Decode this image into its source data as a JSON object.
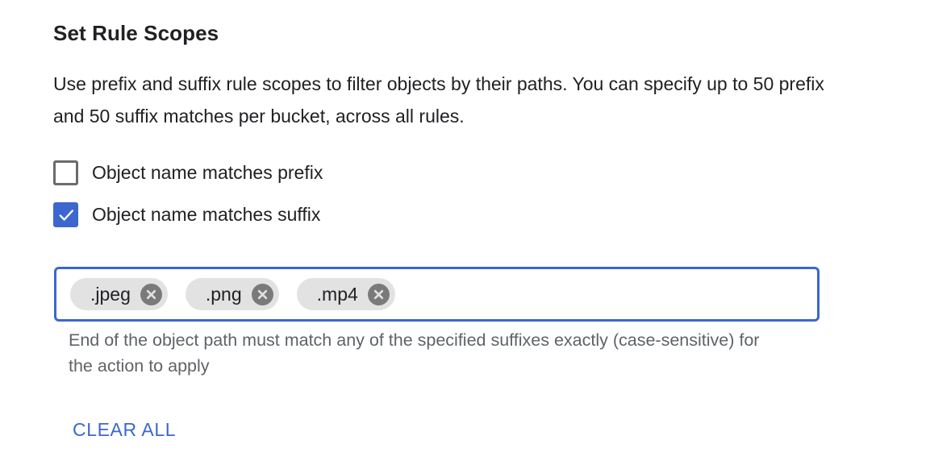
{
  "section": {
    "title": "Set Rule Scopes",
    "description": "Use prefix and suffix rule scopes to filter objects by their paths. You can specify up to 50 prefix and 50 suffix matches per bucket, across all rules."
  },
  "options": {
    "prefix": {
      "label": "Object name matches prefix",
      "checked": false
    },
    "suffix": {
      "label": "Object name matches suffix",
      "checked": true
    }
  },
  "suffix_input": {
    "chips": [
      ".jpeg",
      ".png",
      ".mp4"
    ],
    "value": "",
    "hint": "End of the object path must match any of the specified suffixes exactly (case-sensitive) for the action to apply"
  },
  "actions": {
    "clear_all_label": "CLEAR ALL"
  },
  "colors": {
    "accent": "#3b67cf",
    "chip_bg": "#e2e2e2",
    "hint_text": "#5f6368"
  },
  "icons": {
    "checkmark": "check-icon",
    "chip_remove": "close-circle-icon"
  }
}
